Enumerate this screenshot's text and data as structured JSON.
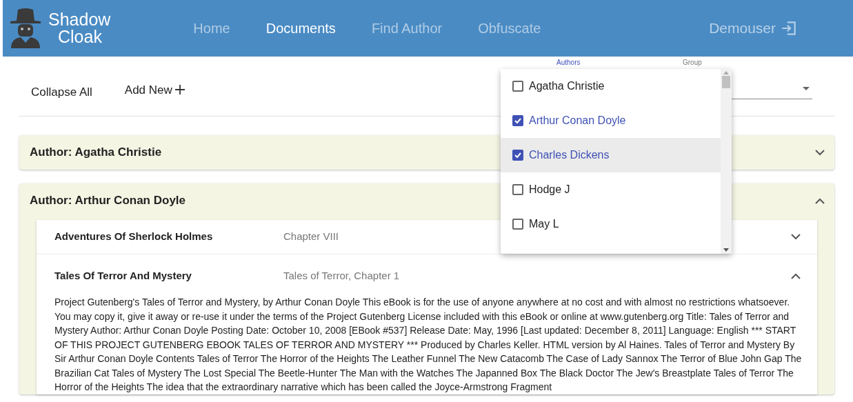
{
  "header": {
    "brand": [
      "Shadow",
      "Cloak"
    ],
    "nav": [
      {
        "label": "Home",
        "selected": false
      },
      {
        "label": "Documents",
        "selected": true
      },
      {
        "label": "Find Author",
        "selected": false
      },
      {
        "label": "Obfuscate",
        "selected": false
      }
    ],
    "user": "Demouser"
  },
  "toolbar": {
    "collapse_all": "Collapse All",
    "add_new": "Add New"
  },
  "filters": [
    {
      "label": "Authors"
    },
    {
      "label": "Group"
    }
  ],
  "authors_menu": [
    {
      "label": "Agatha Christie",
      "checked": false,
      "highlighted": false
    },
    {
      "label": "Arthur Conan Doyle",
      "checked": true,
      "highlighted": false
    },
    {
      "label": "Charles Dickens",
      "checked": true,
      "highlighted": true
    },
    {
      "label": "Hodge J",
      "checked": false,
      "highlighted": false
    },
    {
      "label": "May L",
      "checked": false,
      "highlighted": false
    }
  ],
  "groups": [
    {
      "title": "Author: Agatha Christie",
      "expanded": false
    },
    {
      "title": "Author: Arthur Conan Doyle",
      "expanded": true,
      "documents": [
        {
          "title": "Adventures Of Sherlock Holmes",
          "chapter": "Chapter VIII",
          "expanded": false
        },
        {
          "title": "Tales Of Terror And Mystery",
          "chapter": "Tales of Terror, Chapter 1",
          "expanded": true,
          "text": "Project Gutenberg's Tales of Terror and Mystery, by Arthur Conan Doyle This eBook is for the use of anyone anywhere at no cost and with almost no restrictions whatsoever. You may copy it, give it away or re-use it under the terms of the Project Gutenberg License included with this eBook or online at www.gutenberg.org Title: Tales of Terror and Mystery Author: Arthur Conan Doyle Posting Date: October 10, 2008 [EBook #537] Release Date: May, 1996 [Last updated: December 8, 2011] Language: English *** START OF THIS PROJECT GUTENBERG EBOOK TALES OF TERROR AND MYSTERY *** Produced by Charles Keller. HTML version by Al Haines. Tales of Terror and Mystery By Sir Arthur Conan Doyle Contents Tales of Terror The Horror of the Heights The Leather Funnel The New Catacomb The Case of Lady Sannox The Terror of Blue John Gap The Brazilian Cat Tales of Mystery The Lost Special The Beetle-Hunter The Man with the Watches The Japanned Box The Black Doctor The Jew's Breastplate Tales of Terror The Horror of the Heights The idea that the extraordinary narrative which has been called the Joyce-Armstrong Fragment"
        }
      ]
    }
  ]
}
